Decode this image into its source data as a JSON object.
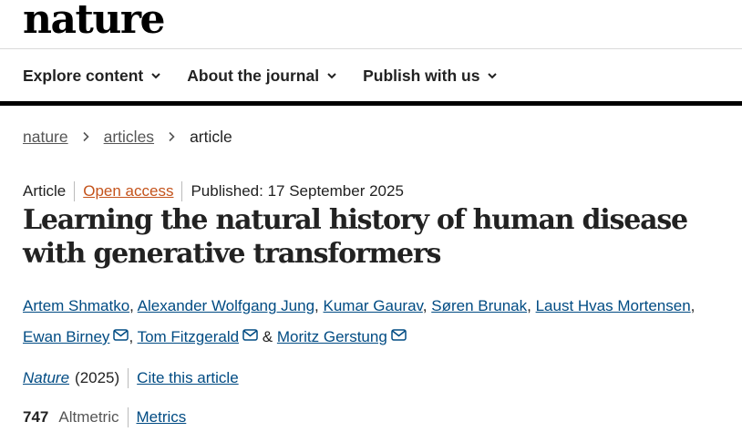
{
  "site": {
    "logo": "nature"
  },
  "nav": {
    "items": [
      {
        "label": "Explore content"
      },
      {
        "label": "About the journal"
      },
      {
        "label": "Publish with us"
      }
    ]
  },
  "breadcrumb": {
    "items": [
      "nature",
      "articles"
    ],
    "current": "article"
  },
  "meta": {
    "type": "Article",
    "access": "Open access",
    "published": "Published: 17 September 2025"
  },
  "article": {
    "title": "Learning the natural history of human disease with generative transformers"
  },
  "authors": {
    "list": [
      "Artem Shmatko",
      "Alexander Wolfgang Jung",
      "Kumar Gaurav",
      "Søren Brunak",
      "Laust Hvas Mortensen",
      "Ewan Birney",
      "Tom Fitzgerald",
      "Moritz Gerstung"
    ],
    "separator": ", ",
    "ampersand": "&"
  },
  "citation": {
    "journal": "Nature",
    "year": "(2025)",
    "cite_label": "Cite this article"
  },
  "metrics": {
    "altmetric_value": "747",
    "altmetric_label": "Altmetric",
    "metrics_label": "Metrics"
  },
  "colors": {
    "link": "#004b83",
    "open_access": "#c4531b",
    "nav_bar": "#000000"
  }
}
